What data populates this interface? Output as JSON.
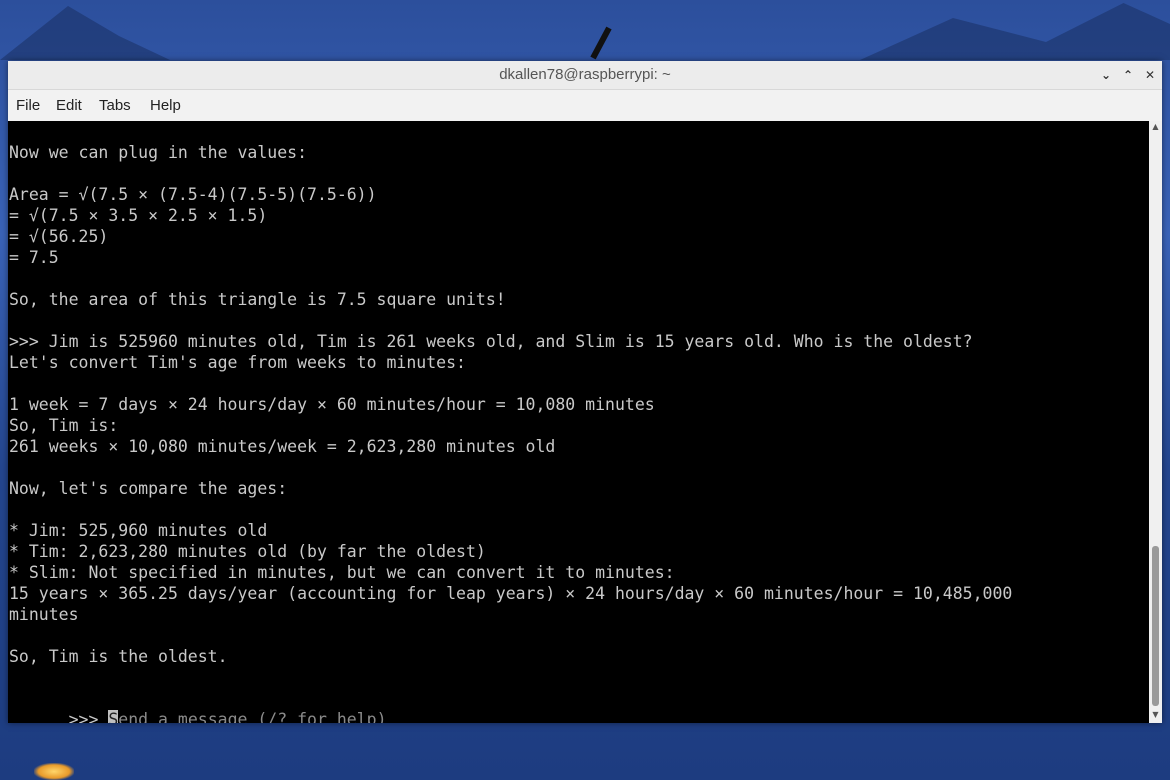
{
  "window": {
    "title": "dkallen78@raspberrypi: ~",
    "controls": {
      "minimize": "⌄",
      "maximize": "⌃",
      "close": "✕"
    }
  },
  "menu": [
    "File",
    "Edit",
    "Tabs",
    "Help"
  ],
  "terminal": {
    "lines": [
      "Now we can plug in the values:",
      "",
      "Area = √(7.5 × (7.5-4)(7.5-5)(7.5-6))",
      "= √(7.5 × 3.5 × 2.5 × 1.5)",
      "= √(56.25)",
      "= 7.5",
      "",
      "So, the area of this triangle is 7.5 square units!",
      "",
      ">>> Jim is 525960 minutes old, Tim is 261 weeks old, and Slim is 15 years old. Who is the oldest?",
      "Let's convert Tim's age from weeks to minutes:",
      "",
      "1 week = 7 days × 24 hours/day × 60 minutes/hour = 10,080 minutes",
      "So, Tim is:",
      "261 weeks × 10,080 minutes/week = 2,623,280 minutes old",
      "",
      "Now, let's compare the ages:",
      "",
      "* Jim: 525,960 minutes old",
      "* Tim: 2,623,280 minutes old (by far the oldest)",
      "* Slim: Not specified in minutes, but we can convert it to minutes:",
      "15 years × 365.25 days/year (accounting for leap years) × 24 hours/day × 60 minutes/hour = 10,485,000",
      "minutes",
      "",
      "So, Tim is the oldest.",
      ""
    ],
    "prompt": ">>> ",
    "cursor_char": "S",
    "placeholder_rest": "end a message (/? for help)"
  },
  "scrollbar": {
    "up_arrow": "▲",
    "down_arrow": "▼"
  }
}
